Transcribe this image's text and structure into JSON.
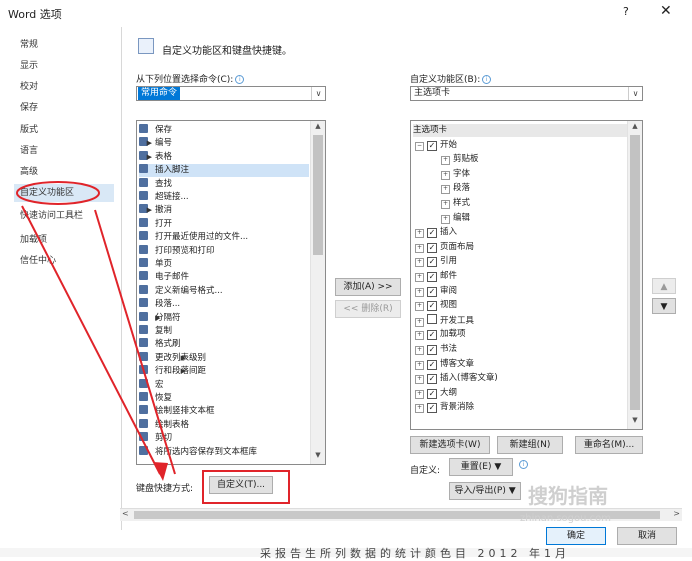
{
  "window": {
    "title": "Word 选项",
    "help": "?",
    "close": "✕"
  },
  "sidebar": {
    "items": [
      {
        "label": "常规"
      },
      {
        "label": "显示"
      },
      {
        "label": "校对"
      },
      {
        "label": "保存"
      },
      {
        "label": "版式"
      },
      {
        "label": "语言"
      },
      {
        "label": "高级"
      },
      {
        "label": "自定义功能区"
      },
      {
        "label": "快速访问工具栏"
      },
      {
        "label": "加载项"
      },
      {
        "label": "信任中心"
      }
    ],
    "selected_index": 7
  },
  "header": {
    "text": "自定义功能区和键盘快捷键。"
  },
  "left": {
    "choose_label": "从下列位置选择命令(C):",
    "choose_value": "常用命令",
    "commands": [
      {
        "label": "保存"
      },
      {
        "label": "编号",
        "submenu": true
      },
      {
        "label": "表格",
        "submenu": true
      },
      {
        "label": "插入脚注"
      },
      {
        "label": "查找"
      },
      {
        "label": "超链接..."
      },
      {
        "label": "撤消",
        "submenu": true
      },
      {
        "label": "打开"
      },
      {
        "label": "打开最近使用过的文件..."
      },
      {
        "label": "打印预览和打印"
      },
      {
        "label": "单页"
      },
      {
        "label": "电子邮件"
      },
      {
        "label": "定义新编号格式..."
      },
      {
        "label": "段落..."
      },
      {
        "label": "分隔符",
        "submenu": true
      },
      {
        "label": "复制"
      },
      {
        "label": "格式刷"
      },
      {
        "label": "更改列表级别",
        "submenu": true
      },
      {
        "label": "行和段落间距",
        "submenu": true
      },
      {
        "label": "宏"
      },
      {
        "label": "恢复"
      },
      {
        "label": "绘制竖排文本框"
      },
      {
        "label": "绘制表格"
      },
      {
        "label": "剪切"
      },
      {
        "label": "将所选内容保存到文本框库"
      }
    ],
    "selected_index": 3,
    "keyboard_label": "键盘快捷方式:",
    "custom_button": "自定义(T)..."
  },
  "right": {
    "ribbon_label": "自定义功能区(B):",
    "ribbon_value": "主选项卡",
    "tree": [
      {
        "label": "主选项卡",
        "level": 0
      },
      {
        "label": "开始",
        "level": 1,
        "expanded": true,
        "checked": true
      },
      {
        "label": "剪贴板",
        "level": 2
      },
      {
        "label": "字体",
        "level": 2
      },
      {
        "label": "段落",
        "level": 2
      },
      {
        "label": "样式",
        "level": 2
      },
      {
        "label": "编辑",
        "level": 2
      },
      {
        "label": "插入",
        "level": 1,
        "checked": true
      },
      {
        "label": "页面布局",
        "level": 1,
        "checked": true
      },
      {
        "label": "引用",
        "level": 1,
        "checked": true
      },
      {
        "label": "邮件",
        "level": 1,
        "checked": true
      },
      {
        "label": "审阅",
        "level": 1,
        "checked": true
      },
      {
        "label": "视图",
        "level": 1,
        "checked": true
      },
      {
        "label": "开发工具",
        "level": 1,
        "checked": false
      },
      {
        "label": "加载项",
        "level": 1,
        "checked": true
      },
      {
        "label": "书法",
        "level": 1,
        "checked": true
      },
      {
        "label": "博客文章",
        "level": 1,
        "checked": true
      },
      {
        "label": "插入(博客文章)",
        "level": 1,
        "checked": true
      },
      {
        "label": "大纲",
        "level": 1,
        "checked": true
      },
      {
        "label": "背景消除",
        "level": 1,
        "checked": true
      }
    ],
    "new_tab": "新建选项卡(W)",
    "new_group": "新建组(N)",
    "rename": "重命名(M)...",
    "custom_label": "自定义:",
    "reset": "重置(E) ▼",
    "import_export": "导入/导出(P) ▼"
  },
  "middle": {
    "add": "添加(A) >>",
    "remove": "<< 删除(R)"
  },
  "footer": {
    "ok": "确定",
    "cancel": "取消"
  },
  "overlay": {
    "watermark": "搜狗指南",
    "watermark_url": "zhinan.sogou.com",
    "background_text": "采报告生所列数据的统计颜色目 2012 年1月"
  },
  "colors": {
    "accent": "#0078d7",
    "selection": "#d9e8f6",
    "annotation": "#e0242a"
  }
}
